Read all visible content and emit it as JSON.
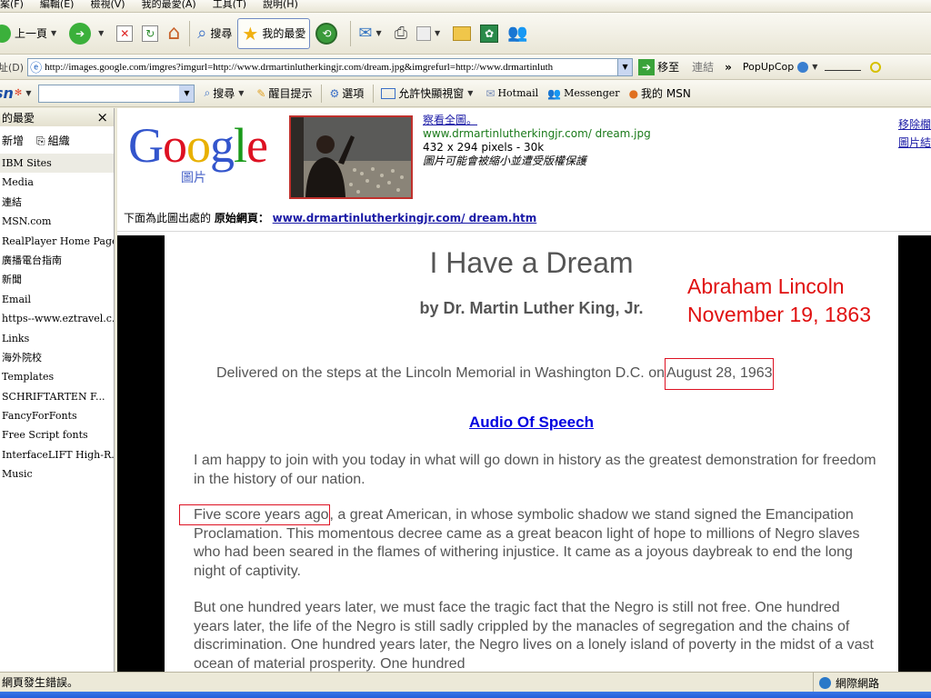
{
  "menubar": {
    "items": [
      "案(F)",
      "編輯(E)",
      "檢視(V)",
      "我的最愛(A)",
      "工具(T)",
      "說明(H)"
    ]
  },
  "toolbar": {
    "back": "上一頁",
    "search": "搜尋",
    "favorites": "我的最愛"
  },
  "addressbar": {
    "label": "址(D)",
    "url": "http://images.google.com/imgres?imgurl=http://www.drmartinlutherkingjr.com/dream.jpg&imgrefurl=http://www.drmartinluth",
    "go": "移至",
    "links": "連結",
    "more": "»",
    "popup": "PopUpCop"
  },
  "linksbar": {
    "search": "搜尋",
    "highlight": "醒目提示",
    "options": "選項",
    "popups": "允許快顯視窗",
    "hotmail": "Hotmail",
    "messenger": "Messenger",
    "mymsn": "我的 MSN"
  },
  "favorites": {
    "title": "的最愛",
    "close": "×",
    "add": "新增",
    "organize": "組織",
    "items": [
      "IBM Sites",
      "Media",
      "連結",
      "MSN.com",
      "RealPlayer Home Page",
      "廣播電台指南",
      "新聞",
      "Email",
      "https--www.eztravel.c...",
      "Links",
      "海外院校",
      "Templates",
      "SCHRIFTARTEN  F...",
      "FancyForFonts",
      "Free Script fonts",
      "InterfaceLIFT High-R...",
      "Music"
    ]
  },
  "google": {
    "logo_sub": "圖片",
    "view_full": "察看全圖。",
    "site": "www.drmartinlutherkingjr.com/ dream.jpg",
    "dims": "432 x 294 pixels - 30k",
    "notice": "圖片可能會被縮小並遭受版權保護",
    "remove_frame": "移除欄",
    "image_results": "圖片結",
    "origin_prefix": "下面為此圖出處的 ",
    "origin_bold": "原始網頁：",
    "origin_link": "www.drmartinlutherkingjr.com/ dream.htm"
  },
  "speech": {
    "title": "I Have a Dream",
    "byline": "by Dr. Martin Luther King, Jr.",
    "delivered": "Delivered on the steps at the Lincoln Memorial in Washington D.C. on",
    "date": "August 28, 1963",
    "audio": "Audio Of Speech",
    "p1": "I am happy to join with you today in what will go down in history as the greatest demonstration for freedom in the history of our nation.",
    "p2_highlight": "Five score years ago",
    "p2_rest": ", a great American, in whose symbolic shadow we stand signed the Emancipation Proclamation. This momentous decree came as a great beacon light of hope to millions of Negro slaves who had been seared in the flames of withering injustice. It came as a joyous daybreak to end the long night of captivity.",
    "p3": "But one hundred years later, we must face the tragic fact that the Negro is still not free. One hundred years later, the life of the Negro is still sadly crippled by the manacles of segregation and the chains of discrimination. One hundred years later, the Negro lives on a lonely island of poverty in the midst of a vast ocean of material prosperity. One hundred"
  },
  "annotation": {
    "line1": "Abraham Lincoln",
    "line2": "November 19, 1863"
  },
  "status": {
    "text": "網頁發生錯誤。",
    "zone": "網際網路"
  },
  "colors": {
    "annotation_red": "#e01010",
    "link_blue": "#1a1aa6",
    "xp_bar": "#ece9d8"
  }
}
